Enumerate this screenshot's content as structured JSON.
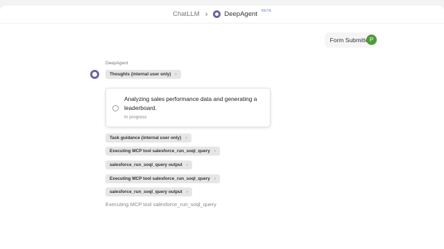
{
  "header": {
    "home": "ChatLLM",
    "app_name": "DeepAgent",
    "badge": "BETA"
  },
  "user_message": {
    "text": "Form Submitted",
    "avatar_initial": "P"
  },
  "agent": {
    "label": "DeepAgent",
    "thoughts_pill": "Thoughts (internal user only)",
    "task_card": {
      "title": "Analyzing sales performance data and generating a leaderboard.",
      "status": "In progress"
    },
    "pills": [
      "Task guidance (internal user only)",
      "Executing MCP tool salesforce_run_soql_query",
      "salesforce_run_soql_query output",
      "Executing MCP tool salesforce_run_soql_query",
      "salesforce_run_soql_query output"
    ],
    "executing_text": "Executing MCP tool salesforce_run_soql_query"
  }
}
